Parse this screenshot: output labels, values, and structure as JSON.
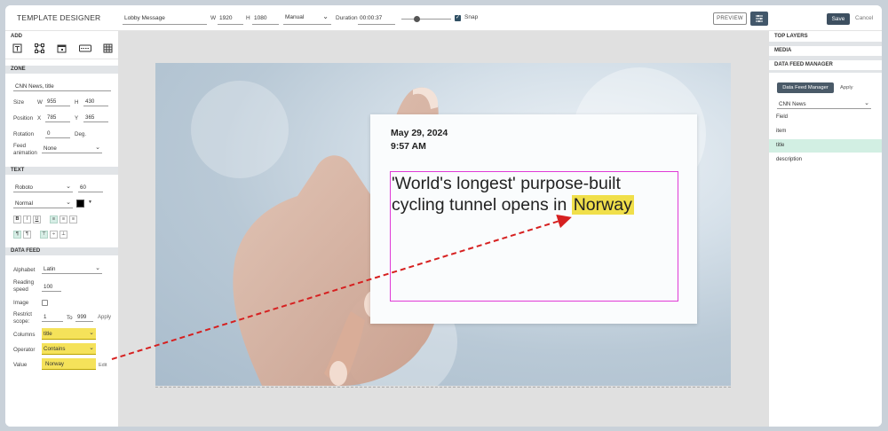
{
  "app": {
    "title": "TEMPLATE DESIGNER"
  },
  "toolbar": {
    "template_name": "Lobby Message",
    "w_label": "W",
    "width": "1920",
    "h_label": "H",
    "height": "1080",
    "mode": "Manual",
    "duration_label": "Duration",
    "duration": "00:00:37",
    "snap_label": "Snap",
    "snap_checked": true,
    "preview_label": "PREVIEW",
    "save_label": "Save",
    "cancel_label": "Cancel"
  },
  "left": {
    "add_title": "ADD",
    "add_icons": [
      "text-icon",
      "zone-icon",
      "calendar-icon",
      "ticker-icon",
      "table-icon"
    ],
    "zone_title": "ZONE",
    "zone_name": "CNN News, title",
    "size_label": "Size",
    "w_label": "W",
    "w_value": "955",
    "h_label": "H",
    "h_value": "430",
    "position_label": "Position",
    "x_label": "X",
    "x_value": "785",
    "y_label": "Y",
    "y_value": "365",
    "rotation_label": "Rotation",
    "rotation_value": "0",
    "deg_label": "Deg.",
    "feed_anim_label": "Feed animation",
    "feed_anim_value": "None",
    "text_title": "TEXT",
    "font_family": "Roboto",
    "font_size": "60",
    "font_weight": "Normal",
    "text_color": "#000000",
    "data_feed_title": "DATA FEED",
    "alphabet_label": "Alphabet",
    "alphabet_value": "Latin",
    "reading_speed_label": "Reading speed",
    "reading_speed_value": "100",
    "image_label": "Image",
    "restrict_label": "Restrict scope:",
    "restrict_from": "1",
    "to_label": "To",
    "restrict_to": "999",
    "apply_label": "Apply",
    "columns_label": "Columns",
    "columns_value": "title",
    "operator_label": "Operator",
    "operator_value": "Contains",
    "value_label": "Value",
    "value_value": "Norway",
    "edit_label": "Edit"
  },
  "canvas": {
    "date": "May 29, 2024",
    "time": "9:57 AM",
    "headline_pre": "'World's longest' purpose-built cycling tunnel opens in ",
    "headline_hl": "Norway"
  },
  "right": {
    "top_layers": "TOP LAYERS",
    "media": "MEDIA",
    "dfm_title": "DATA FEED MANAGER",
    "tab_active": "Data Feed Manager",
    "tab_apply": "Apply",
    "feed_select": "CNN News",
    "field_header": "Field",
    "fields": [
      "item",
      "title",
      "description"
    ],
    "selected_field": "title"
  },
  "colors": {
    "accent": "#3d4f60",
    "highlight": "#f5e25a",
    "selection_green": "#d2efe3",
    "zone_border": "#e03ad6",
    "arrow": "#d62020"
  }
}
